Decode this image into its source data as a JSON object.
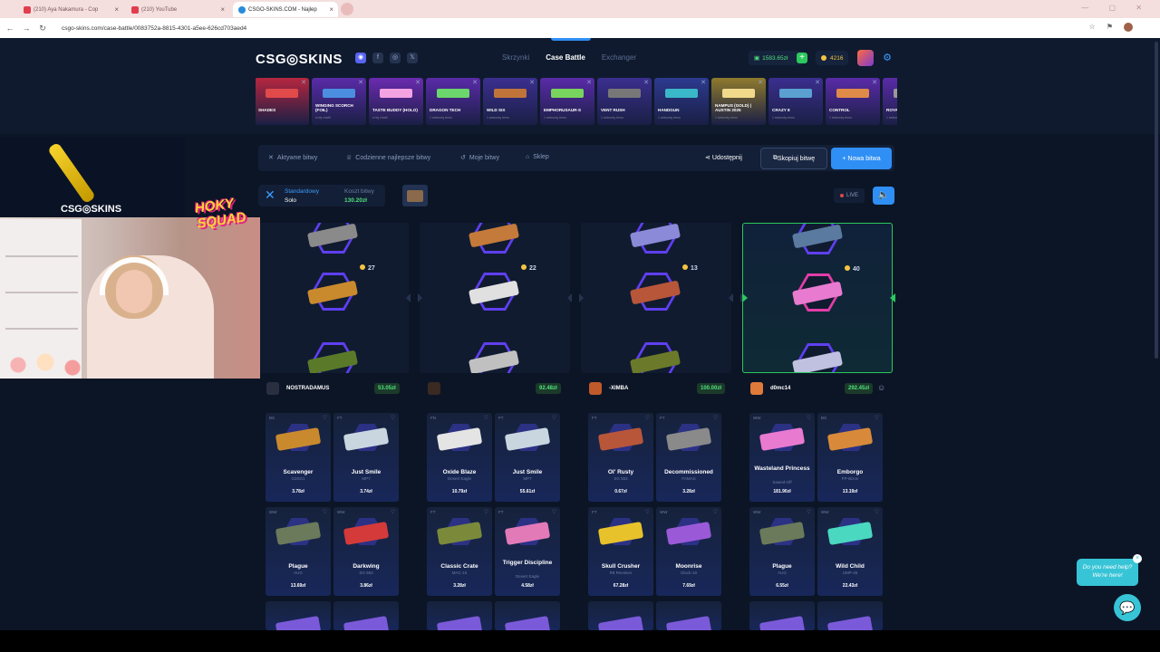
{
  "browser": {
    "tabs": [
      {
        "label": "(210) Aya Nakamura - Cop"
      },
      {
        "label": "(210) YouTube"
      },
      {
        "label": "CSGO-SKINS.COM - Najlep"
      }
    ],
    "url": "csgo-skins.com/case-battle/0083752a-8815-4301-a5ee-626cd703aed4"
  },
  "site": {
    "logo": "CSG◎SKINS",
    "nav": {
      "cases": "Skrzynki",
      "battle": "Case Battle",
      "exchanger": "Exchanger"
    },
    "balance": "1583.65zł",
    "coins": "4216",
    "accent": "#2f8ff5",
    "green": "#4fe07c"
  },
  "drops": [
    {
      "name": "SHADES",
      "sub": "",
      "color": "#b5263f",
      "gun": "#e04a4a"
    },
    {
      "name": "WINGING SCORCH (FOIL)",
      "sub": "w tej chwili",
      "color": "#5a2ba8",
      "gun": "#4b8ee0"
    },
    {
      "name": "TASTE BUDDY (HOLO)",
      "sub": "w tej chwili",
      "color": "#6b2bb0",
      "gun": "#f3a2e2"
    },
    {
      "name": "DRAGON TECH",
      "sub": "1 sekundę temu",
      "color": "#5a2ba8",
      "gun": "#6bd66b"
    },
    {
      "name": "WILD SIX",
      "sub": "1 sekundę temu",
      "color": "#3b2f8f",
      "gun": "#c0743a"
    },
    {
      "name": "EMPHORUSAUR-S",
      "sub": "1 sekundę temu",
      "color": "#5a2ba8",
      "gun": "#79d45e"
    },
    {
      "name": "VENT RUSH",
      "sub": "1 sekundę temu",
      "color": "#3b2f8f",
      "gun": "#777"
    },
    {
      "name": "HANDGUN",
      "sub": "1 sekundę temu",
      "color": "#2d3a8f",
      "gun": "#3ab7c9"
    },
    {
      "name": "NAMPUS (GOLD) | AUSTIN 2025",
      "sub": "1 sekundę temu",
      "color": "#8f7a2d",
      "gun": "#f0d98a"
    },
    {
      "name": "CRAZY 8",
      "sub": "1 sekundę temu",
      "color": "#3b2f8f",
      "gun": "#5aa0d0"
    },
    {
      "name": "CONTROL",
      "sub": "1 sekundę temu",
      "color": "#5a2ba8",
      "gun": "#e08a4a"
    },
    {
      "name": "ROYAL",
      "sub": "1 sekundę temu",
      "color": "#5a2ba8",
      "gun": "#999"
    }
  ],
  "toolbar": {
    "active": "Aktywne bitwy",
    "daily": "Codzienne najlepsze bitwy",
    "mine": "Moje bitwy",
    "shop": "Sklep",
    "share": "Udostępnij",
    "copy": "Skopiuj bitwę",
    "new": "+ Nowa bitwa"
  },
  "mode": {
    "name": "Standardowy",
    "sub": "Solo",
    "cost_label": "Koszt bitwy",
    "cost": "130.20zł"
  },
  "live": "LIVE",
  "reels": [
    {
      "count": "27"
    },
    {
      "count": "22"
    },
    {
      "count": "13"
    },
    {
      "count": "40"
    }
  ],
  "players": [
    {
      "name": "NOSTRADAMUS",
      "total": "53.05zł",
      "items": [
        {
          "cond": "BS",
          "name": "Scavenger",
          "sub": "G3SG1",
          "price": "3.78zł",
          "gun": "#c98a2e"
        },
        {
          "cond": "FT",
          "name": "Just Smile",
          "sub": "MP7",
          "price": "3.74zł",
          "gun": "#c9d6e0"
        },
        {
          "cond": "WW",
          "name": "Plague",
          "sub": "AUG",
          "price": "13.69zł",
          "gun": "#6b7a5a"
        },
        {
          "cond": "WW",
          "name": "Darkwing",
          "sub": "SG 553",
          "price": "3.86zł",
          "gun": "#d43a3a"
        }
      ]
    },
    {
      "name": "",
      "total": "92.48zł",
      "items": [
        {
          "cond": "FN",
          "name": "Oxide Blaze",
          "sub": "Desert Eagle",
          "price": "10.79zł",
          "gun": "#e4e4e4"
        },
        {
          "cond": "FT",
          "name": "Just Smile",
          "sub": "MP7",
          "price": "55.61zł",
          "gun": "#c9d6e0"
        },
        {
          "cond": "FT",
          "name": "Classic Crate",
          "sub": "MAC-10",
          "price": "3.28zł",
          "gun": "#7a8a3a"
        },
        {
          "cond": "FT",
          "name": "Trigger Discipline",
          "sub": "Desert Eagle",
          "price": "4.58zł",
          "gun": "#e27ab8"
        }
      ]
    },
    {
      "name": "-XIMBA",
      "total": "100.00zł",
      "items": [
        {
          "cond": "FT",
          "name": "Ol' Rusty",
          "sub": "SG 553",
          "price": "0.67zł",
          "gun": "#b8563a"
        },
        {
          "cond": "FT",
          "name": "Decommissioned",
          "sub": "FAMAS",
          "price": "3.28zł",
          "gun": "#8a8a8a"
        },
        {
          "cond": "FT",
          "name": "Skull Crusher",
          "sub": "R8 Revolver",
          "price": "67.28zł",
          "gun": "#e8c22a"
        },
        {
          "cond": "WW",
          "name": "Moonrise",
          "sub": "Glock-18",
          "price": "7.69zł",
          "gun": "#9a5ad8"
        }
      ]
    },
    {
      "name": "d0mc14",
      "total": "292.45zł",
      "items": [
        {
          "cond": "WW",
          "name": "Wasteland Princess",
          "sub": "Sawed-Off",
          "price": "181.90zł",
          "gun": "#e87ad0"
        },
        {
          "cond": "BS",
          "name": "Emborgo",
          "sub": "PP-Bizon",
          "price": "13.19zł",
          "gun": "#d88a3a"
        },
        {
          "cond": "WW",
          "name": "Plague",
          "sub": "AUG",
          "price": "6.55zł",
          "gun": "#6b7a5a"
        },
        {
          "cond": "WW",
          "name": "Wild Child",
          "sub": "UMP-45",
          "price": "22.43zł",
          "gun": "#4ad8c0"
        }
      ]
    }
  ],
  "overlay": {
    "logo": "CSG◎SKINS",
    "squad": "HOKY SQUAD"
  },
  "chat": {
    "line1": "Do you need help?",
    "line2": "We're here!"
  }
}
